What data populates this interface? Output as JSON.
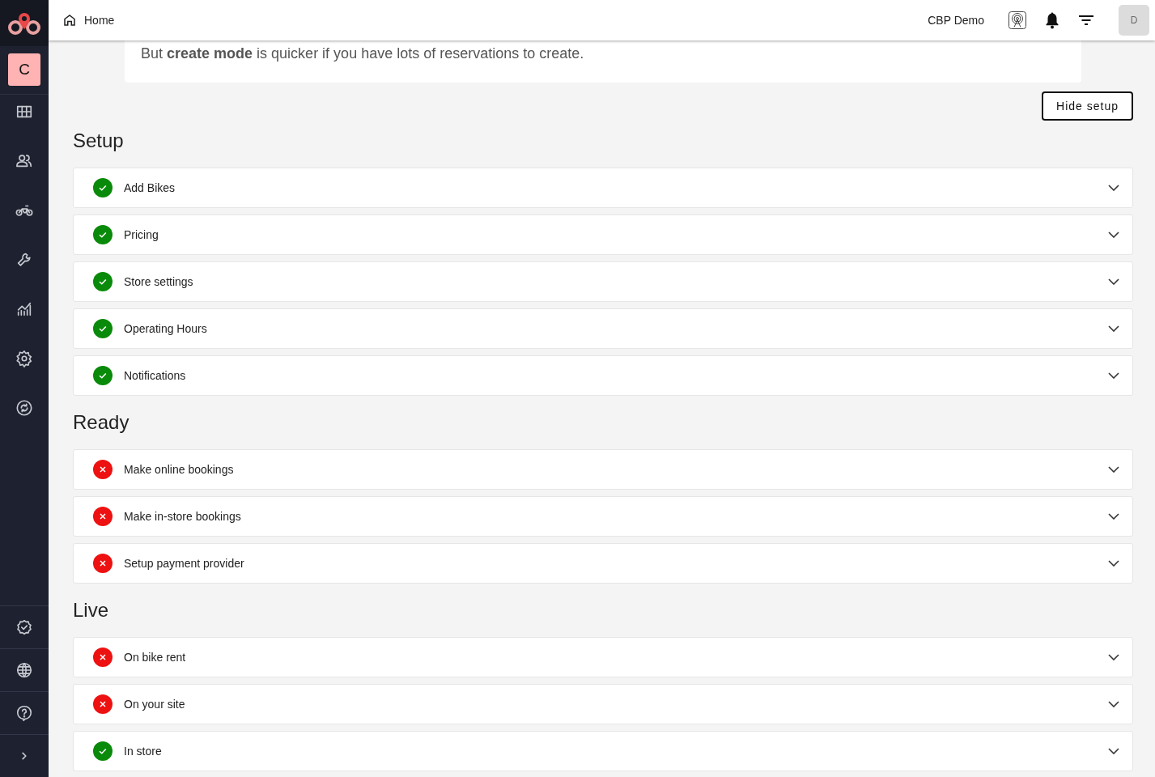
{
  "header": {
    "breadcrumb": "Home",
    "account": "CBP Demo",
    "avatar": "D"
  },
  "sidebar": {
    "store_initial": "C"
  },
  "intro": {
    "text": "But **create mode** is quicker if you have lots of reservations to create."
  },
  "hide_button": "Hide setup",
  "sections": [
    {
      "title": "Setup",
      "items": [
        {
          "label": "Add Bikes",
          "complete": true
        },
        {
          "label": "Pricing",
          "complete": true
        },
        {
          "label": "Store settings",
          "complete": true
        },
        {
          "label": "Operating Hours",
          "complete": true
        },
        {
          "label": "Notifications",
          "complete": true
        }
      ]
    },
    {
      "title": "Ready",
      "items": [
        {
          "label": "Make online bookings",
          "complete": false
        },
        {
          "label": "Make in-store bookings",
          "complete": false
        },
        {
          "label": "Setup payment provider",
          "complete": false
        }
      ]
    },
    {
      "title": "Live",
      "items": [
        {
          "label": "On bike rent",
          "complete": false
        },
        {
          "label": "On your site",
          "complete": false
        },
        {
          "label": "In store",
          "complete": true
        }
      ]
    }
  ]
}
